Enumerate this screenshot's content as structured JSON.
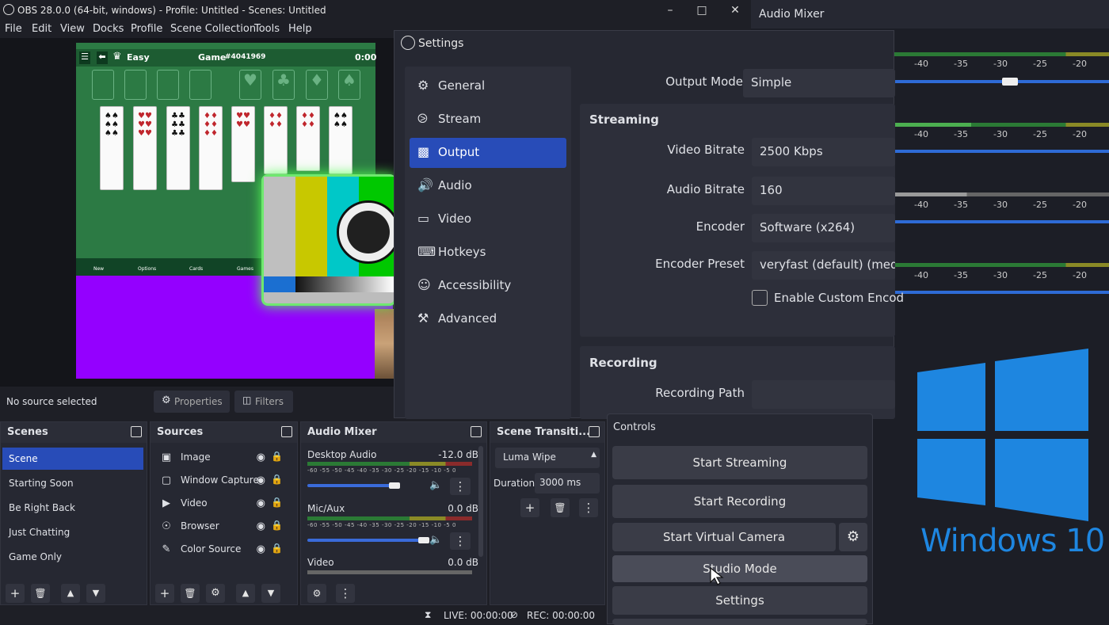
{
  "window": {
    "title": "OBS 28.0.0 (64-bit, windows) - Profile: Untitled - Scenes: Untitled"
  },
  "menu": [
    "File",
    "Edit",
    "View",
    "Docks",
    "Profile",
    "Scene Collection",
    "Tools",
    "Help"
  ],
  "preview": {
    "game": {
      "difficulty": "Easy",
      "game_label": "Game",
      "game_number": "#4041969",
      "timer": "0:00",
      "menu_label": "Menu",
      "back_label": "Back",
      "bottom": [
        "New",
        "Options",
        "Cards",
        "Games"
      ]
    }
  },
  "source_bar": {
    "text": "No source selected",
    "properties": "Properties",
    "filters": "Filters"
  },
  "scenes": {
    "title": "Scenes",
    "items": [
      "Scene",
      "Starting Soon",
      "Be Right Back",
      "Just Chatting",
      "Game Only"
    ],
    "selected": 0
  },
  "sources": {
    "title": "Sources",
    "items": [
      {
        "label": "Image",
        "icon": "image-icon"
      },
      {
        "label": "Window Capture",
        "icon": "window-icon"
      },
      {
        "label": "Video",
        "icon": "play-icon"
      },
      {
        "label": "Browser",
        "icon": "globe-icon"
      },
      {
        "label": "Color Source",
        "icon": "brush-icon"
      }
    ]
  },
  "mixer": {
    "title": "Audio Mixer",
    "ticks": "-60 -55 -50 -45 -40 -35 -30 -25 -20 -15 -10 -5 0",
    "channels": [
      {
        "name": "Desktop Audio",
        "db": "-12.0 dB",
        "volume": 0.75
      },
      {
        "name": "Mic/Aux",
        "db": "0.0 dB",
        "volume": 1.0
      },
      {
        "name": "Video",
        "db": "0.0 dB"
      }
    ]
  },
  "transitions": {
    "title": "Scene Transiti...",
    "selected": "Luma Wipe",
    "duration_label": "Duration",
    "duration": "3000 ms"
  },
  "status": {
    "live": "LIVE: 00:00:00",
    "rec": "REC: 00:00:00"
  },
  "settings": {
    "title": "Settings",
    "nav": [
      {
        "label": "General",
        "icon": "gear-icon"
      },
      {
        "label": "Stream",
        "icon": "antenna-icon"
      },
      {
        "label": "Output",
        "icon": "output-icon"
      },
      {
        "label": "Audio",
        "icon": "speaker-icon"
      },
      {
        "label": "Video",
        "icon": "monitor-icon"
      },
      {
        "label": "Hotkeys",
        "icon": "keyboard-icon"
      },
      {
        "label": "Accessibility",
        "icon": "accessibility-icon"
      },
      {
        "label": "Advanced",
        "icon": "tools-icon"
      }
    ],
    "selected": 2,
    "output_mode_label": "Output Mode",
    "output_mode": "Simple",
    "streaming": {
      "title": "Streaming",
      "video_bitrate_label": "Video Bitrate",
      "video_bitrate": "2500 Kbps",
      "audio_bitrate_label": "Audio Bitrate",
      "audio_bitrate": "160",
      "encoder_label": "Encoder",
      "encoder": "Software (x264)",
      "preset_label": "Encoder Preset",
      "preset": "veryfast (default) (mediu",
      "custom_label": "Enable Custom Encod"
    },
    "recording": {
      "title": "Recording",
      "path_label": "Recording Path",
      "path": ""
    }
  },
  "right_mixer": {
    "title": "Audio Mixer",
    "ticks": [
      "-40",
      "-35",
      "-30",
      "-25",
      "-20"
    ],
    "slider_value": 0.54
  },
  "controls": {
    "title": "Controls",
    "buttons": [
      "Start Streaming",
      "Start Recording",
      "Start Virtual Camera",
      "Studio Mode",
      "Settings"
    ]
  },
  "overlay": {
    "windows_text": "Windows 10"
  },
  "colors": {
    "accent": "#284cb8",
    "windows": "#1e86e0"
  }
}
